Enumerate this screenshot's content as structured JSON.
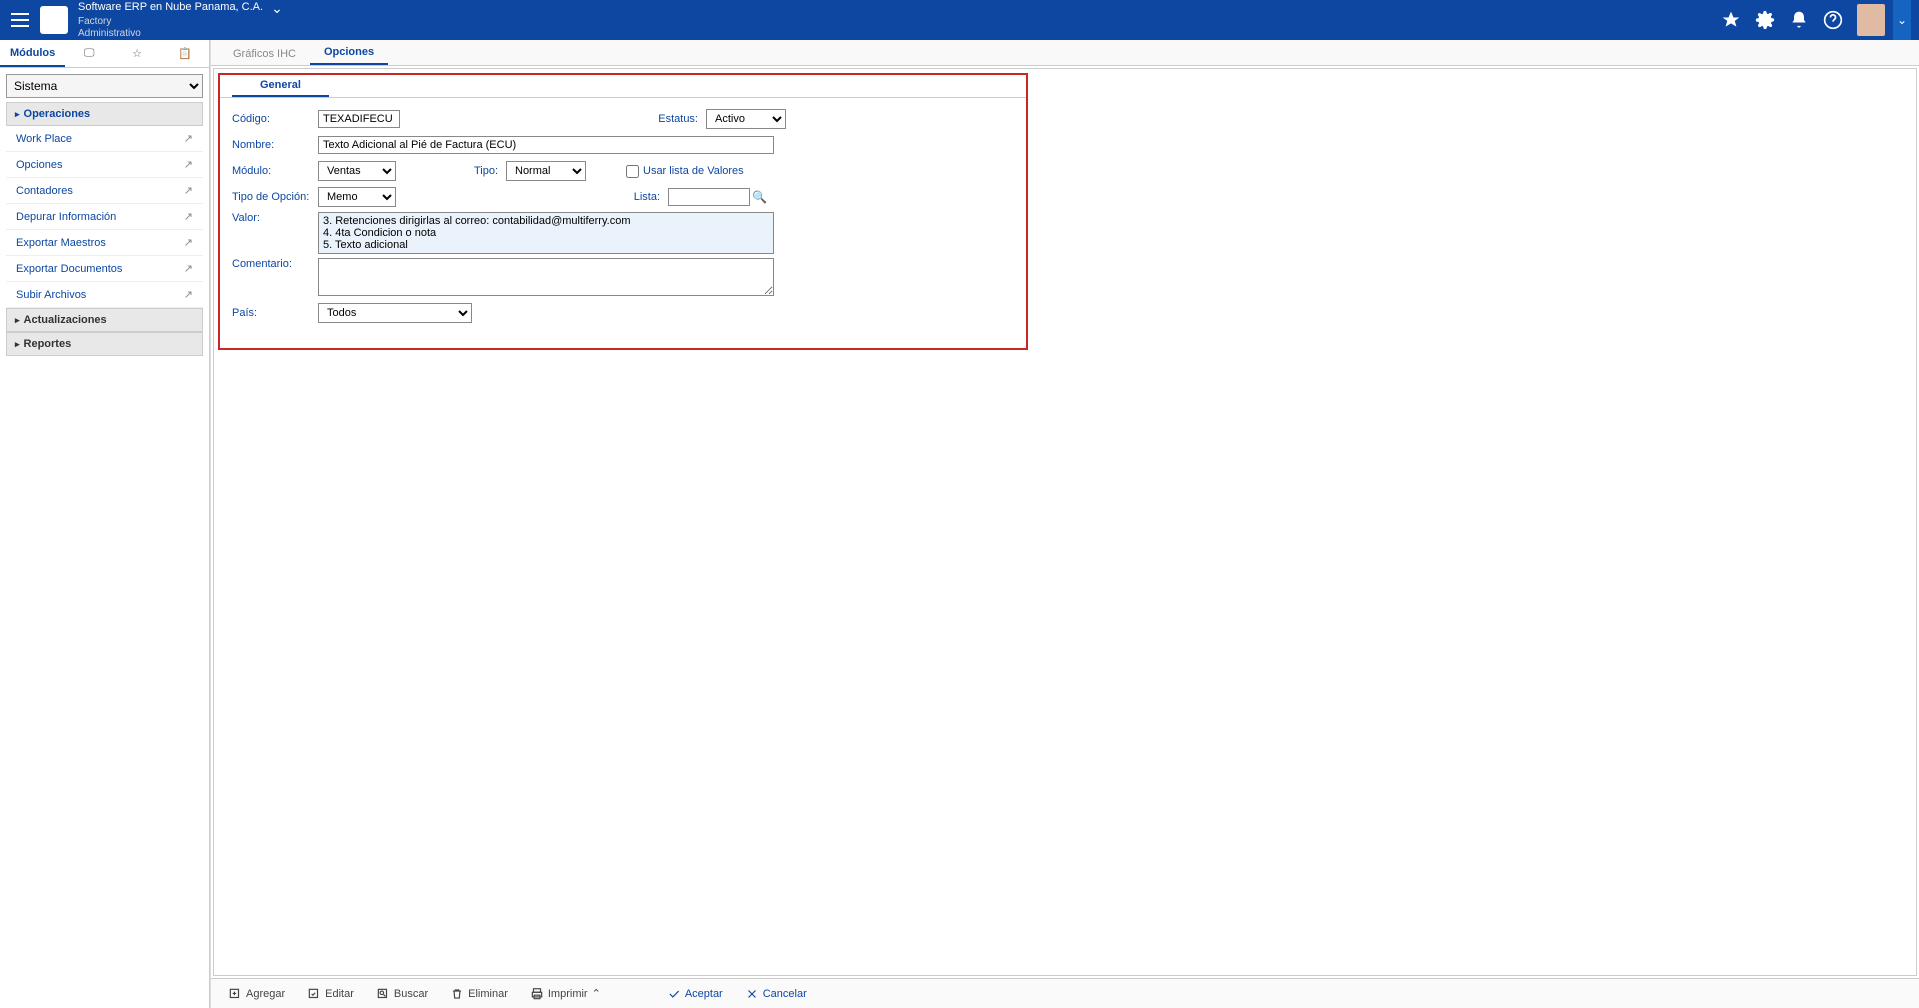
{
  "header": {
    "company": "Software ERP en Nube Panama, C.A.",
    "line2": "Factory",
    "line3": "Administrativo"
  },
  "sidebar": {
    "tab_modules": "Módulos",
    "select_value": "Sistema",
    "section_operaciones": "Operaciones",
    "section_actualizaciones": "Actualizaciones",
    "section_reportes": "Reportes",
    "items": [
      {
        "label": "Work Place"
      },
      {
        "label": "Opciones"
      },
      {
        "label": "Contadores"
      },
      {
        "label": "Depurar Información"
      },
      {
        "label": "Exportar Maestros"
      },
      {
        "label": "Exportar Documentos"
      },
      {
        "label": "Subir Archivos"
      }
    ]
  },
  "content_tabs": {
    "graficos": "Gráficos IHC",
    "opciones": "Opciones"
  },
  "form": {
    "tab_general": "General",
    "labels": {
      "codigo": "Código:",
      "estatus": "Estatus:",
      "nombre": "Nombre:",
      "modulo": "Módulo:",
      "tipo": "Tipo:",
      "usar_lista": "Usar lista de Valores",
      "tipo_opcion": "Tipo de Opción:",
      "lista": "Lista:",
      "valor": "Valor:",
      "comentario": "Comentario:",
      "pais": "País:"
    },
    "values": {
      "codigo": "TEXADIFECU",
      "estatus": "Activo",
      "nombre": "Texto Adicional al Pié de Factura (ECU)",
      "modulo": "Ventas",
      "tipo": "Normal",
      "tipo_opcion": "Memo",
      "lista": "",
      "valor": "3. Retenciones dirigirlas al correo: contabilidad@multiferry.com\n4. 4ta Condicion o nota\n5. Texto adicional",
      "comentario": "",
      "pais": "Todos"
    }
  },
  "footer": {
    "agregar": "Agregar",
    "editar": "Editar",
    "buscar": "Buscar",
    "eliminar": "Eliminar",
    "imprimir": "Imprimir",
    "aceptar": "Aceptar",
    "cancelar": "Cancelar"
  }
}
